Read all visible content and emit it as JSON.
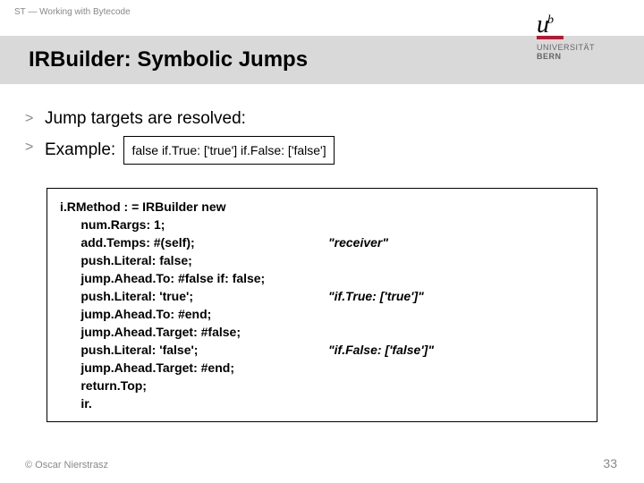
{
  "header": {
    "prefix": "ST — Working with Bytecode",
    "title": "IRBuilder: Symbolic Jumps"
  },
  "logo": {
    "university": "UNIVERSITÄT",
    "city": "BERN"
  },
  "bullets": {
    "b1": "Jump targets are resolved:",
    "b2": "Example:",
    "inline_code": "false if.True: ['true'] if.False: ['false']"
  },
  "code": {
    "l0": "i.RMethod : = IRBuilder new",
    "l1": "      num.Rargs: 1;",
    "l2": "      add.Temps: #(self);",
    "l3": "      push.Literal: false;",
    "l4": "      jump.Ahead.To: #false if: false;",
    "l5": "      push.Literal: 'true';",
    "l6": "      jump.Ahead.To: #end;",
    "l7": "      jump.Ahead.Target: #false;",
    "l8": "      push.Literal: 'false';",
    "l9": "      jump.Ahead.Target: #end;",
    "l10": "      return.Top;",
    "l11": "      ir.",
    "c2": "\"receiver\"",
    "c5": "\"if.True: ['true']\"",
    "c8": "\"if.False: ['false']\""
  },
  "footer": {
    "copyright": "© Oscar Nierstrasz",
    "page": "33"
  }
}
